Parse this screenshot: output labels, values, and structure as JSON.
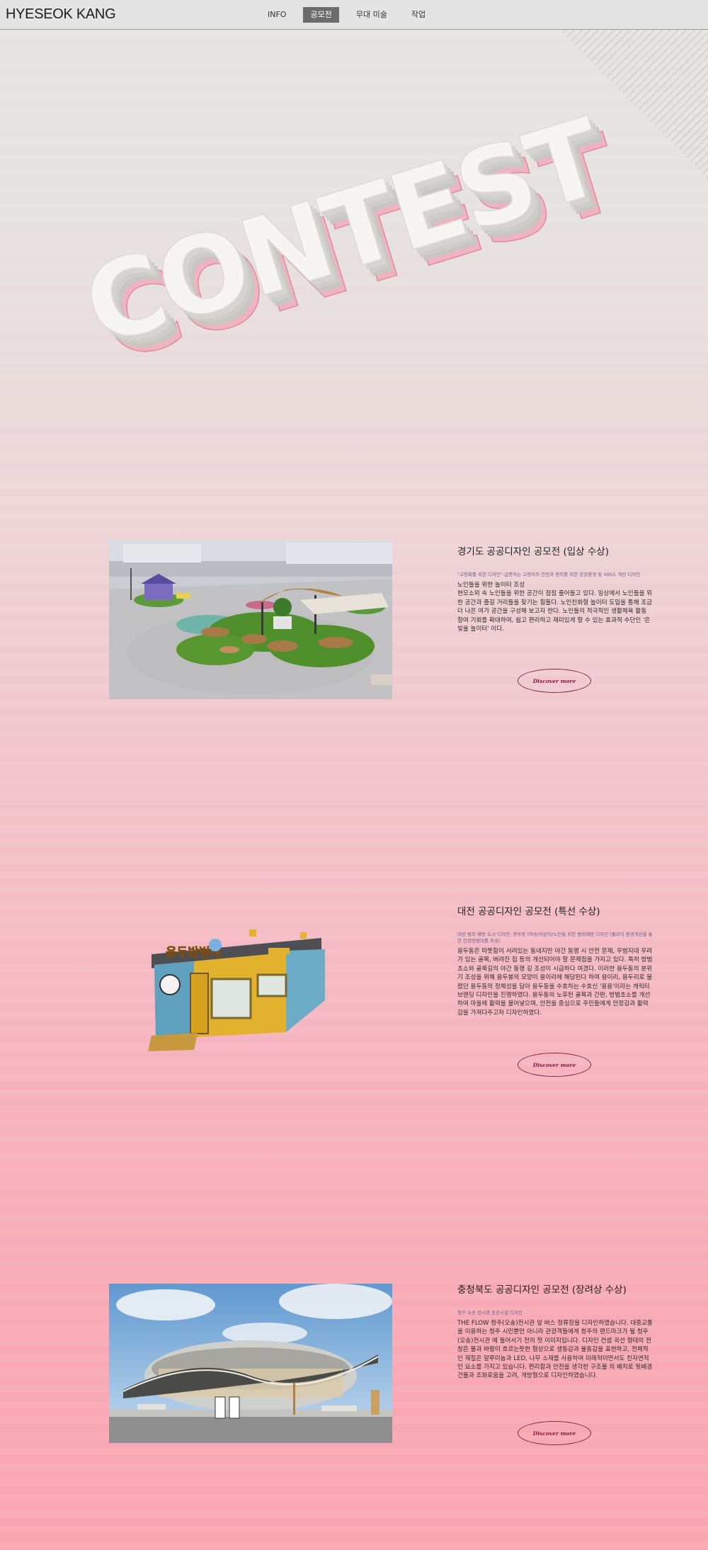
{
  "header": {
    "brand": "HYESEOK KANG",
    "nav": [
      {
        "label": "INFO",
        "active": false
      },
      {
        "label": "공모전",
        "active": true
      },
      {
        "label": "무대 미술",
        "active": false
      },
      {
        "label": "작업",
        "active": false
      }
    ]
  },
  "hero": {
    "title": "CONTEST"
  },
  "projects": [
    {
      "title": "경기도 공공디자인 공모전 (입상 수상)",
      "subtitle": "\"고령화를 위한 디자인\"-급증하는 고령자의 안전과 편의를 위한 공공환경 및 서비스 개선 디자인",
      "body": "노인들을 위한 놀이터 조성\n현모소외 속 노인들을 위한 공간이 점점 줄어들고 있다. 일상에서 노인들을 위한 공간과 즐길 거리들을 찾기는 힘들다. 노인친화형 놀이터 도입을 통해 조금 더 나은 여가 공간을 구성해 보고자 한다. 노인들의 적극적인 생활체육 활동 참여 기회를 확대하여, 쉽고 편리하고 재미있게 할 수 있는 효과적 수단인 '은빛울 놀이터' 이다.",
      "image": "playground-render",
      "button": "Discover more"
    },
    {
      "title": "대전 공공디자인 공모전 (특선 수상)",
      "subtitle": "대전 범죄 예방 도시 디자인- 용두동 (여성/어린이/노인을 위한 범죄예방 디자인 (둘리지 환경개선을 통한 안전방범대를 조성)",
      "body": "용두동은 따뜻함이 서려있는 동네지만 야간 동행 시 안전 문제, 우범지대 우려가 있는 골목, 버려진 집 등의 개선되어야 할 문제점을 가지고 있다. 특히 방범초소와 골목길의 야간 동행 길 조성이 시급하다 여겼다. 이러한 용두동의 분위기 조성을 위해 용두봉의 모양이 용이리에 해당된다 하여 용이리, 용두리로 불렸던 용두동의 정체성을 담아 용두동을 수호하는 수호신 '용용'이라는 캐릭터 브랜딩 디자인을 진행하였다. 용두동의 노후된 골목과 간판, 방범초소를 개선하여 마을에 활력을 불어넣으며, 안전을 중심으로 주민들에게 안정감과 활력감을 가져다주고자 디자인하였다.",
      "image": "container-render",
      "button": "Discover more"
    },
    {
      "title": "충청북도 공공디자인 공모전 (장려상 수상)",
      "subtitle": "청주 오송 전시관 공공시설 디자인",
      "body": "THE FLOW 청주(오송)전시관 앞 버스 정류장을 디자인하였습니다. 대중교통을 이용하는 청주 시민뿐만 아니라 관광객들에게 청주의 랜드마크가 될 청주(오송)전시관 에 들어서기 전의 첫 이미지입니다. 디자인 컨셉 곡선 형태의 전창은 물과 바람이 흐르는듯한 형상으로 생동감과 율동감을 표현하고, 전체적인 재질은 알루미늄과 LED, 나무 소재를 사용하여 미래적이면서도 친자연적인 요소를 가지고 있습니다. 편리함과 안전을 생각한 구조물 의 배치로 뒷배경 건물과 조화로움을 고려, 개방형으로 디자인하였습니다.",
      "image": "bus-stop-render",
      "button": "Discover more"
    }
  ]
}
